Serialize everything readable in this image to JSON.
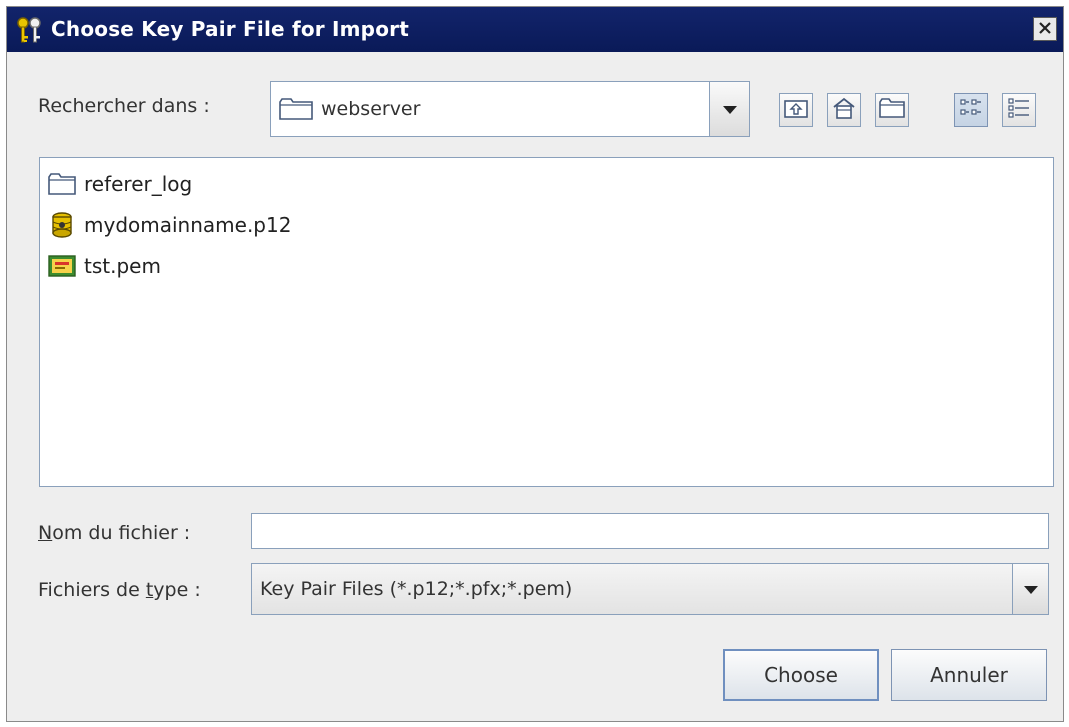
{
  "window": {
    "title": "Choose Key Pair File for Import"
  },
  "lookin": {
    "label": "Rechercher dans :",
    "value": "webserver"
  },
  "toolbar": {
    "icons": [
      "up-folder-icon",
      "home-icon",
      "new-folder-icon",
      "list-view-icon",
      "details-view-icon"
    ]
  },
  "files": [
    {
      "name": "referer_log",
      "icon": "folder-icon"
    },
    {
      "name": "mydomainname.p12",
      "icon": "keystore-icon"
    },
    {
      "name": "tst.pem",
      "icon": "certificate-icon"
    }
  ],
  "filename": {
    "label_mnemonic": "N",
    "label_rest": "om du fichier :",
    "value": ""
  },
  "filetype": {
    "label_pre": "Fichiers de ",
    "label_mnemonic": "t",
    "label_post": "ype :",
    "value": "Key Pair Files (*.p12;*.pfx;*.pem)"
  },
  "buttons": {
    "choose": "Choose",
    "cancel": "Annuler"
  },
  "colors": {
    "titlebar": "#0a1a58",
    "background": "#eeeeee",
    "border": "#8aa0bb"
  }
}
